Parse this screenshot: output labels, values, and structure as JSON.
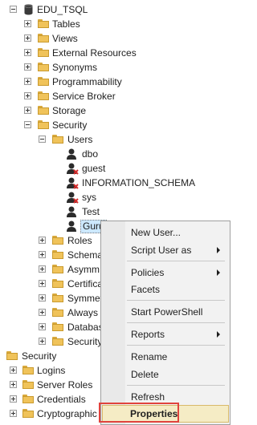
{
  "tree": {
    "database": "EDU_TSQL",
    "db_children": [
      "Tables",
      "Views",
      "External Resources",
      "Synonyms",
      "Programmability",
      "Service Broker",
      "Storage",
      "Security"
    ],
    "security_children": [
      "Users"
    ],
    "users": [
      "dbo",
      "guest",
      "INFORMATION_SCHEMA",
      "sys",
      "Test",
      "Guru"
    ],
    "security_folders_partial": [
      "Roles",
      "Schema",
      "Asymm",
      "Certifica",
      "Symmet",
      "Always E",
      "Databas",
      "Security"
    ],
    "server_security": "Security",
    "server_security_children": [
      "Logins",
      "Server Roles",
      "Credentials",
      "Cryptographic"
    ]
  },
  "context_menu": {
    "items": [
      {
        "label": "New User...",
        "has_submenu": false
      },
      {
        "label": "Script User as",
        "has_submenu": true
      },
      {
        "label": "Policies",
        "has_submenu": true
      },
      {
        "label": "Facets",
        "has_submenu": false
      },
      {
        "label": "Start PowerShell",
        "has_submenu": false
      },
      {
        "label": "Reports",
        "has_submenu": true
      },
      {
        "label": "Rename",
        "has_submenu": false
      },
      {
        "label": "Delete",
        "has_submenu": false
      },
      {
        "label": "Refresh",
        "has_submenu": false
      },
      {
        "label": "Properties",
        "has_submenu": false
      }
    ],
    "highlighted": "Properties"
  },
  "colors": {
    "folder": "#f0c35a",
    "selection": "#cce8ff",
    "highlight_frame": "#e0433d"
  }
}
